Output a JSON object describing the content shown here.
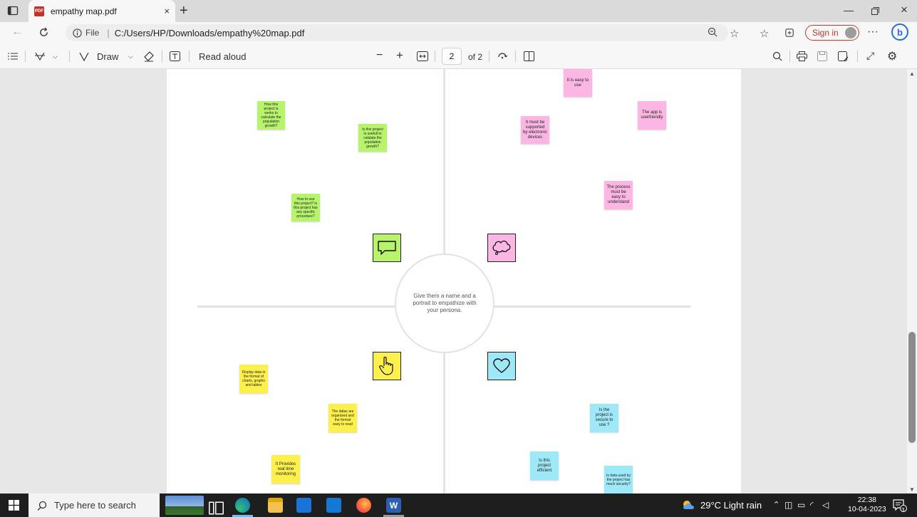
{
  "browser": {
    "tab_title": "empathy map.pdf",
    "tab_close": "×",
    "new_tab": "+",
    "url_prefix": "File",
    "url": "C:/Users/HP/Downloads/empathy%20map.pdf",
    "sign_in": "Sign in",
    "more": "···"
  },
  "pdf_toolbar": {
    "draw": "Draw",
    "read_aloud": "Read aloud",
    "zoom_out": "−",
    "zoom_in": "+",
    "page_current": "2",
    "page_total": "of 2"
  },
  "empathy_map": {
    "center_text": "Give them a name and a portrait to empathize with your persona.",
    "notes": [
      {
        "id": "green-1",
        "text": "How this project is works to calculate the population growth?"
      },
      {
        "id": "green-2",
        "text": "Is this project is usefull to calulate the population growth?"
      },
      {
        "id": "green-3",
        "text": "How to use this project? is this project has any specific procedure?"
      },
      {
        "id": "pink-1",
        "text": "It is easy to use"
      },
      {
        "id": "pink-2",
        "text": "The app is userfriendly"
      },
      {
        "id": "pink-3",
        "text": "It must be supported by electronic devices"
      },
      {
        "id": "pink-4",
        "text": "The process must be easy to understand"
      },
      {
        "id": "yellow-1",
        "text": "Display data in the format of charts, graphs and tables"
      },
      {
        "id": "yellow-2",
        "text": "The datas are organized and the format easy to read"
      },
      {
        "id": "yellow-3",
        "text": "It Provides real time monitoring"
      },
      {
        "id": "blue-1",
        "text": "Is the project is secure to use ?"
      },
      {
        "id": "blue-2",
        "text": "Is this project efficient"
      },
      {
        "id": "blue-3",
        "text": "Is data used by the project has much security?"
      }
    ],
    "colors": {
      "green": "#b7f46c",
      "pink": "#fbb6e3",
      "yellow": "#fdf04d",
      "blue": "#9fe8f7"
    }
  },
  "taskbar": {
    "search_placeholder": "Type here to search",
    "weather": "29°C  Light rain",
    "time": "22:38",
    "date": "10-04-2023",
    "notification_count": "3"
  }
}
